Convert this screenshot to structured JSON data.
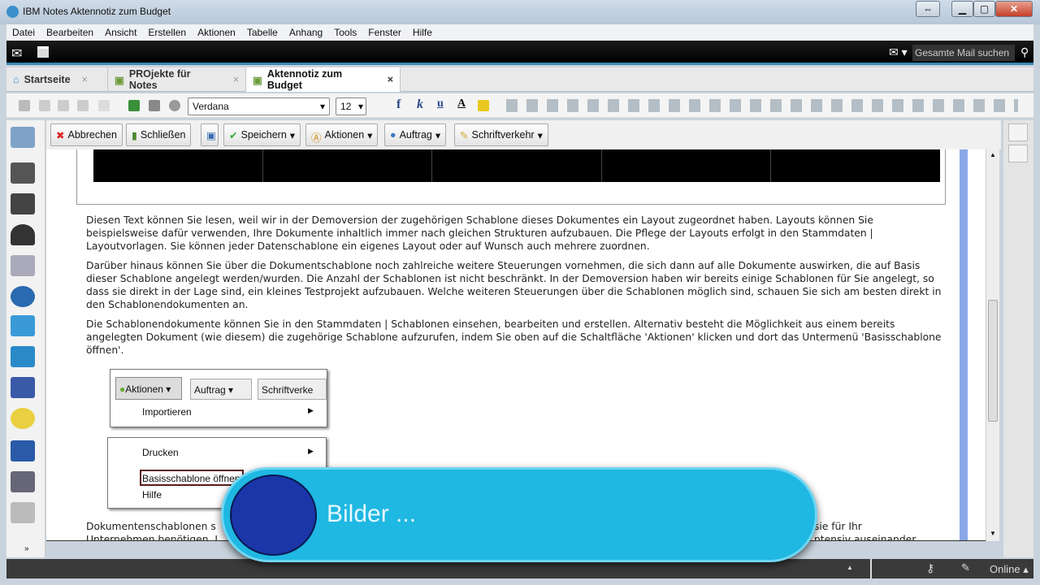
{
  "window": {
    "title": "IBM Notes Aktennotiz zum Budget"
  },
  "menu": [
    "Datei",
    "Bearbeiten",
    "Ansicht",
    "Erstellen",
    "Aktionen",
    "Tabelle",
    "Anhang",
    "Tools",
    "Fenster",
    "Hilfe"
  ],
  "search": {
    "placeholder": "Gesamte Mail suchen"
  },
  "tabs": [
    {
      "label": "Startseite"
    },
    {
      "label": "PROjekte für Notes"
    },
    {
      "label": "Aktennotiz zum Budget"
    }
  ],
  "format": {
    "font": "Verdana",
    "size": "12"
  },
  "actions": {
    "cancel": "Abbrechen",
    "close": "Schließen",
    "save": "Speichern",
    "actions": "Aktionen",
    "order": "Auftrag",
    "correspondence": "Schriftverkehr"
  },
  "doc": {
    "p1": "Diesen Text können Sie lesen, weil wir in der Demoversion der zugehörigen Schablone dieses Dokumentes ein Layout zugeordnet haben. Layouts  können Sie beispielsweise dafür verwenden, Ihre Dokumente inhaltlich immer nach gleichen Strukturen aufzubauen. Die Pflege der Layouts erfolgt in den Stammdaten | Layoutvorlagen. Sie können jeder Datenschablone ein eigenes Layout oder auf Wunsch auch mehrere zuordnen.",
    "p2": "Darüber hinaus  können Sie über die Dokumentschablone noch zahlreiche weitere Steuerungen vornehmen, die sich dann auf alle Dokumente auswirken, die auf Basis dieser Schablone angelegt werden/wurden. Die Anzahl der Schablonen ist nicht beschränkt. In der Demoversion haben wir bereits einige Schablonen für Sie angelegt, so dass sie direkt in der Lage sind, ein kleines Testprojekt aufzubauen. Welche weiteren Steuerungen über die Schablonen möglich sind, schauen Sie sich am besten direkt in den Schablonendokumenten an.",
    "p3": "Die Schablonendokumente können Sie in den Stammdaten | Schablonen einsehen, bearbeiten und erstellen. Alternativ besteht die Möglichkeit aus einem bereits angelegten Dokument (wie diesem) die zugehörige Schablone aufzurufen, indem Sie oben auf die Schaltfläche 'Aktionen' klicken und dort das Untermenü 'Basisschablone öffnen'.",
    "p4a": "Dokumentenschablonen s",
    "p4b": "sie für Ihr",
    "p5a": "Unternehmen benötigen. I",
    "p5b": "ntensiv auseinander"
  },
  "screenshot": {
    "actions": "Aktionen",
    "order": "Auftrag",
    "corr": "Schriftverke",
    "import": "Importieren",
    "print": "Drucken",
    "base": "Basisschablone öffnen",
    "help": "Hilfe"
  },
  "status": {
    "online": "Online"
  },
  "overlay": {
    "text": "Bilder ..."
  }
}
